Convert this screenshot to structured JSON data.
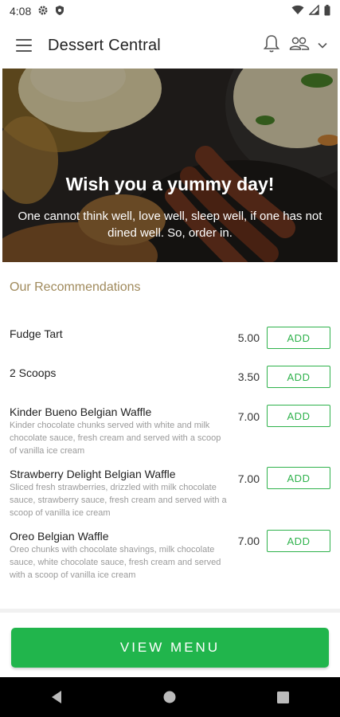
{
  "status_bar": {
    "time": "4:08"
  },
  "app_bar": {
    "title": "Dessert Central"
  },
  "hero": {
    "title": "Wish you a yummy day!",
    "subtitle": "One cannot think well, love well, sleep well, if one has not dined well. So, order in."
  },
  "recommendations": {
    "title": "Our Recommendations",
    "add_label": "ADD",
    "items": [
      {
        "name": "Fudge Tart",
        "description": "",
        "price": "5.00"
      },
      {
        "name": "2 Scoops",
        "description": "",
        "price": "3.50"
      },
      {
        "name": "Kinder Bueno Belgian Waffle",
        "description": "Kinder chocolate chunks served with white and milk chocolate sauce, fresh cream and served with a scoop of vanilla ice cream",
        "price": "7.00"
      },
      {
        "name": "Strawberry Delight Belgian Waffle",
        "description": "Sliced fresh strawberries, drizzled with milk chocolate sauce, strawberry sauce, fresh cream and served with a scoop of vanilla ice cream",
        "price": "7.00"
      },
      {
        "name": "Oreo Belgian Waffle",
        "description": "Oreo chunks with chocolate shavings, milk chocolate sauce, white chocolate sauce, fresh cream and served with a scoop of vanilla ice cream",
        "price": "7.00"
      }
    ]
  },
  "view_menu_label": "VIEW MENU",
  "colors": {
    "accent_green": "#21b54c",
    "section_title": "#a08a5c"
  },
  "icons": [
    "settings-icon",
    "shield-icon",
    "wifi-icon",
    "signal-icon",
    "battery-icon",
    "menu-icon",
    "bell-icon",
    "user-switch-icon",
    "chevron-down-icon",
    "back-icon",
    "home-icon",
    "recents-icon"
  ]
}
